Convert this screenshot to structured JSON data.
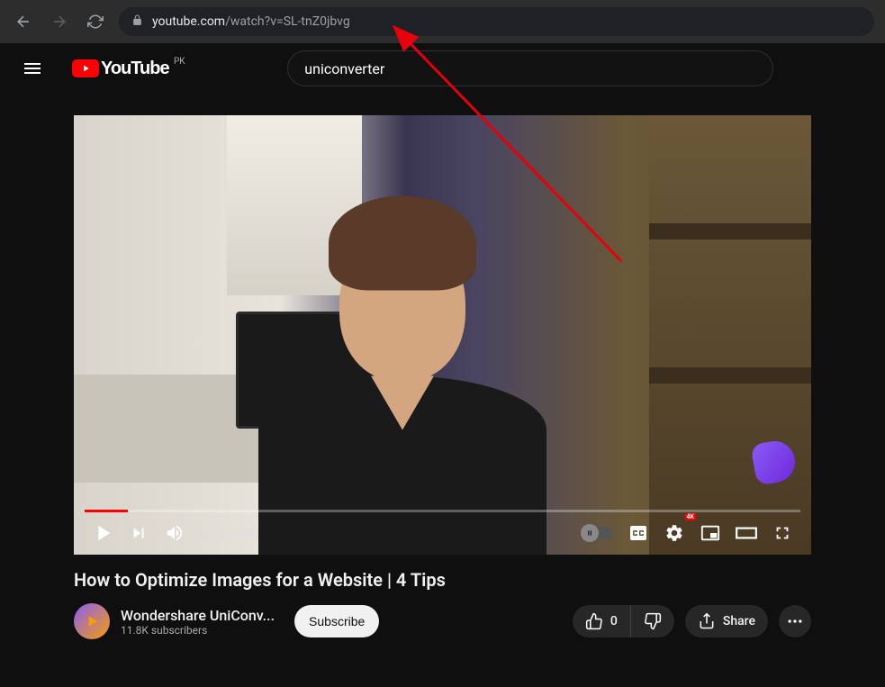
{
  "browser": {
    "url_domain": "youtube.com",
    "url_path": "/watch?v=SL-tnZ0jbvg"
  },
  "header": {
    "country_code": "PK",
    "search_value": "uniconverter"
  },
  "player": {
    "current_time": "0:00",
    "duration": "6:48",
    "quality_badge": "4K"
  },
  "video": {
    "title": "How to Optimize Images for a Website | 4 Tips"
  },
  "channel": {
    "name": "Wondershare UniConv...",
    "subscribers": "11.8K subscribers"
  },
  "actions": {
    "subscribe": "Subscribe",
    "like_count": "0",
    "share": "Share"
  }
}
